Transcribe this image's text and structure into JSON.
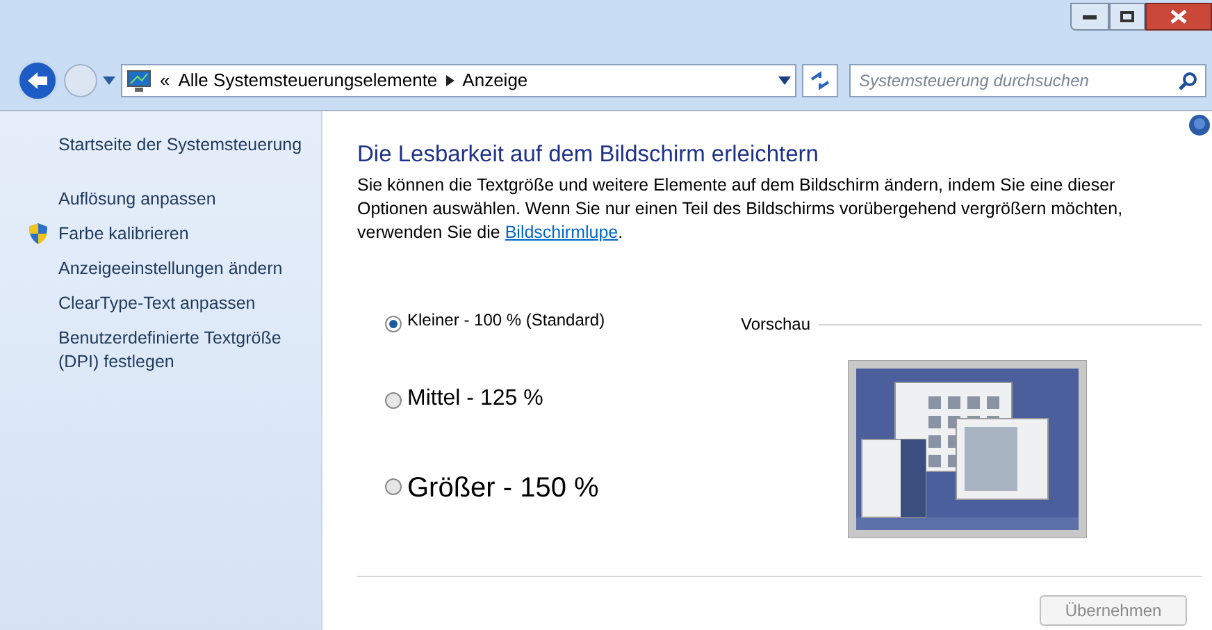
{
  "address_bar": {
    "breadcrumbs": [
      "Alle Systemsteuerungselemente",
      "Anzeige"
    ],
    "overflow": "«"
  },
  "search": {
    "placeholder": "Systemsteuerung durchsuchen"
  },
  "sidebar": {
    "items": [
      {
        "label": "Startseite der Systemsteuerung",
        "kind": "home"
      },
      {
        "label": "Auflösung anpassen",
        "kind": "link"
      },
      {
        "label": "Farbe kalibrieren",
        "kind": "admin"
      },
      {
        "label": "Anzeigeeinstellungen ändern",
        "kind": "link"
      },
      {
        "label": "ClearType-Text anpassen",
        "kind": "link"
      },
      {
        "label": "Benutzerdefinierte Textgröße (DPI) festlegen",
        "kind": "link"
      }
    ]
  },
  "heading": "Die Lesbarkeit auf dem Bildschirm erleichtern",
  "description": {
    "text": "Sie können die Textgröße und weitere Elemente auf dem Bildschirm ändern, indem Sie eine dieser Optionen auswählen. Wenn Sie nur einen Teil des Bildschirms vorübergehend vergrößern möchten, verwenden Sie die",
    "link": "Bildschirmlupe",
    "after": "."
  },
  "options": [
    {
      "label": "Kleiner - 100 % (Standard)",
      "kind": "small",
      "selected": true
    },
    {
      "label": "Mittel - 125 %",
      "kind": "medium",
      "selected": false
    },
    {
      "label": "Größer - 150 %",
      "kind": "large",
      "selected": false
    }
  ],
  "preview": {
    "label": "Vorschau"
  },
  "apply_button": {
    "label": "Übernehmen",
    "disabled": true
  }
}
